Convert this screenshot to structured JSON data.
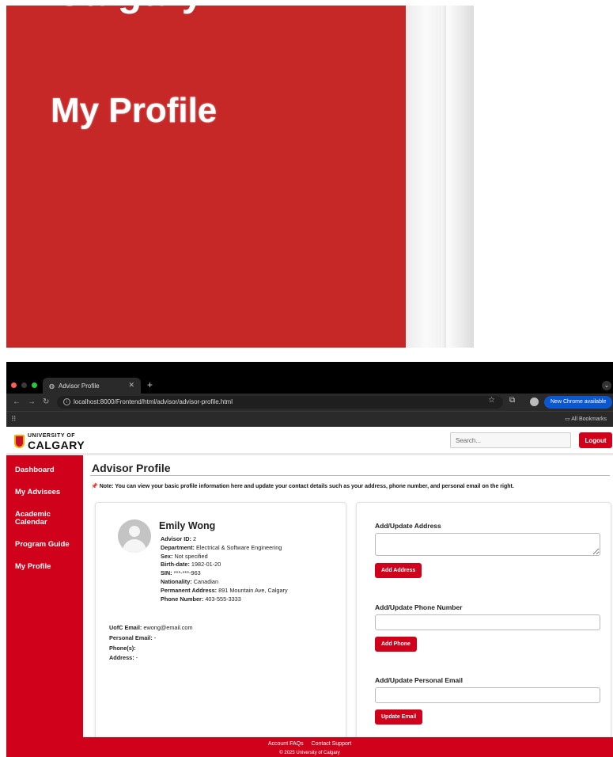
{
  "zoomed": {
    "partial_heading": "Calgary",
    "title": "My Profile",
    "panel_color": "#c62828"
  },
  "browser": {
    "tab_title": "Advisor Profile",
    "url": "localhost:8000/Frontend/html/advisor/advisor-profile.html",
    "new_chrome": "New Chrome available",
    "all_bookmarks": "All Bookmarks"
  },
  "header": {
    "logo_small": "UNIVERSITY OF",
    "logo_big": "CALGARY",
    "search_placeholder": "Search...",
    "logout": "Logout",
    "brand_color": "#d0021b"
  },
  "sidebar": {
    "items": [
      {
        "label": "Dashboard"
      },
      {
        "label": "My Advisees"
      },
      {
        "label": "Academic Calendar"
      },
      {
        "label": "Program Guide"
      },
      {
        "label": "My Profile"
      }
    ]
  },
  "main": {
    "title": "Advisor Profile",
    "note": "Note: You can view your basic profile information here and update your contact details such as your address, phone number, and personal email on the right."
  },
  "profile": {
    "name": "Emily Wong",
    "advisor_id": {
      "label": "Advisor ID:",
      "value": "2"
    },
    "department": {
      "label": "Department:",
      "value": "Electrical & Software Engineering"
    },
    "sex": {
      "label": "Sex:",
      "value": "Not specified"
    },
    "birth_date": {
      "label": "Birth-date:",
      "value": "1982-01-20"
    },
    "sin": {
      "label": "SIN:",
      "value": "***-***-963"
    },
    "nationality": {
      "label": "Nationality:",
      "value": "Canadian"
    },
    "permanent_address": {
      "label": "Permanent Address:",
      "value": "891 Mountain Ave, Calgary"
    },
    "phone": {
      "label": "Phone Number:",
      "value": "403-555-3333"
    },
    "uofc_email": {
      "label": "UofC Email:",
      "value": "ewong@email.com"
    },
    "personal_email": {
      "label": "Personal Email:",
      "value": "-"
    },
    "phones": {
      "label": "Phone(s):",
      "value": ""
    },
    "address": {
      "label": "Address:",
      "value": "-"
    }
  },
  "forms": {
    "address": {
      "label": "Add/Update Address",
      "button": "Add Address"
    },
    "phone": {
      "label": "Add/Update Phone Number",
      "button": "Add Phone"
    },
    "email": {
      "label": "Add/Update Personal Email",
      "button": "Update Email"
    }
  },
  "footer": {
    "faqs": "Account FAQs",
    "support": "Contact Support",
    "copyright": "© 2025 University of Calgary"
  }
}
